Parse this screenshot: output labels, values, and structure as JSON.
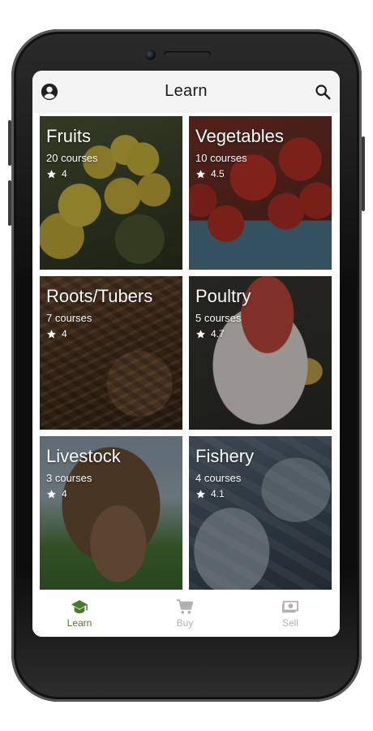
{
  "app_bar": {
    "title": "Learn",
    "left_icon": "account-circle-icon",
    "right_icon": "search-icon"
  },
  "categories": [
    {
      "title": "Fruits",
      "courses": "20 courses",
      "rating": "4"
    },
    {
      "title": "Vegetables",
      "courses": "10 courses",
      "rating": "4.5"
    },
    {
      "title": "Roots/Tubers",
      "courses": "7 courses",
      "rating": "4"
    },
    {
      "title": "Poultry",
      "courses": "5 courses",
      "rating": "4.7"
    },
    {
      "title": "Livestock",
      "courses": "3 courses",
      "rating": "4"
    },
    {
      "title": "Fishery",
      "courses": "4 courses",
      "rating": "4.1"
    }
  ],
  "bottom_nav": {
    "items": [
      {
        "label": "Learn",
        "icon": "graduation-cap-icon",
        "active": true
      },
      {
        "label": "Buy",
        "icon": "shopping-cart-icon",
        "active": false
      },
      {
        "label": "Sell",
        "icon": "money-icon",
        "active": false
      }
    ]
  },
  "colors": {
    "accent": "#4a7a2c",
    "inactive": "#b0b0b0",
    "app_bar_bg": "#f3f3f3"
  }
}
